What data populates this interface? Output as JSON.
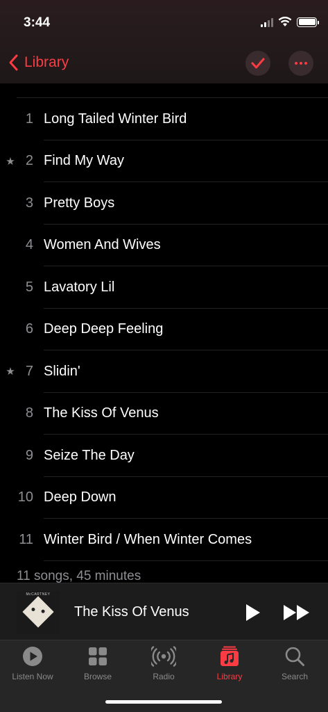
{
  "status_bar": {
    "time": "3:44"
  },
  "navbar": {
    "back_label": "Library",
    "accent_color": "#fc3c44"
  },
  "tracks": [
    {
      "number": "1",
      "title": "Long Tailed Winter Bird",
      "starred": false
    },
    {
      "number": "2",
      "title": "Find My Way",
      "starred": true
    },
    {
      "number": "3",
      "title": "Pretty Boys",
      "starred": false
    },
    {
      "number": "4",
      "title": "Women And Wives",
      "starred": false
    },
    {
      "number": "5",
      "title": "Lavatory Lil",
      "starred": false
    },
    {
      "number": "6",
      "title": "Deep Deep Feeling",
      "starred": false
    },
    {
      "number": "7",
      "title": "Slidin'",
      "starred": true
    },
    {
      "number": "8",
      "title": "The Kiss Of Venus",
      "starred": false
    },
    {
      "number": "9",
      "title": "Seize The Day",
      "starred": false
    },
    {
      "number": "10",
      "title": "Deep Down",
      "starred": false
    },
    {
      "number": "11",
      "title": "Winter Bird / When Winter Comes",
      "starred": false
    }
  ],
  "album_summary": "11 songs, 45 minutes",
  "star_glyph": "★",
  "mini_player": {
    "album_art_text": "McCARTNEY",
    "now_playing_title": "The Kiss Of Venus"
  },
  "tabbar": {
    "tabs": [
      {
        "label": "Listen Now",
        "icon": "play-circle-icon",
        "active": false
      },
      {
        "label": "Browse",
        "icon": "grid-icon",
        "active": false
      },
      {
        "label": "Radio",
        "icon": "radio-waves-icon",
        "active": false
      },
      {
        "label": "Library",
        "icon": "music-library-icon",
        "active": true
      },
      {
        "label": "Search",
        "icon": "search-icon",
        "active": false
      }
    ]
  }
}
